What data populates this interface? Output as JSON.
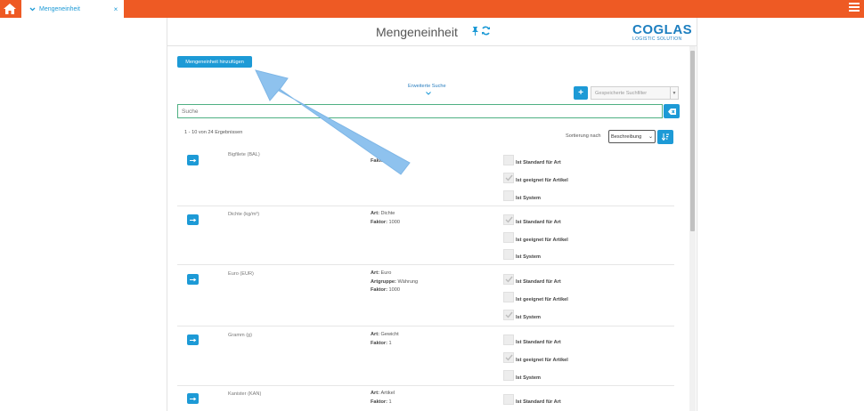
{
  "tab": {
    "label": "Mengeneinheit",
    "close": "×"
  },
  "header": {
    "title": "Mengeneinheit",
    "logo_main": "COGLAS",
    "logo_sub": "LOGISTIC SOLUTION"
  },
  "toolbar": {
    "add_label": "Mengeneinheit hinzufügen",
    "extended_search": "Erweiterte Suche",
    "plus": "+",
    "filter_placeholder": "Gespeicherte Suchfilter"
  },
  "search": {
    "placeholder": "Suche",
    "value": ""
  },
  "results": {
    "count_text": "1 - 10 von 24 Ergebnissen",
    "sort_label": "Sortierung nach",
    "sort_value": "Beschreibung"
  },
  "flag_labels": {
    "standard": "Ist Standard für Art",
    "suitable": "Ist geeignet für Artikel",
    "system": "Ist System"
  },
  "rows": [
    {
      "name": "Bigfilete (BAL)",
      "details": [
        {
          "key": "Faktor",
          "value": "1"
        }
      ],
      "flags": {
        "standard": false,
        "suitable": true,
        "system": false
      }
    },
    {
      "name": "Dichte (kg/m³)",
      "details": [
        {
          "key": "Art",
          "value": "Dichte"
        },
        {
          "key": "Faktor",
          "value": "1000"
        }
      ],
      "flags": {
        "standard": true,
        "suitable": false,
        "system": false
      }
    },
    {
      "name": "Euro (EUR)",
      "details": [
        {
          "key": "Art",
          "value": "Euro"
        },
        {
          "key": "Artgruppe",
          "value": "Währung"
        },
        {
          "key": "Faktor",
          "value": "1000"
        }
      ],
      "flags": {
        "standard": true,
        "suitable": false,
        "system": true
      }
    },
    {
      "name": "Gramm (g)",
      "details": [
        {
          "key": "Art",
          "value": "Gewicht"
        },
        {
          "key": "Faktor",
          "value": "1"
        }
      ],
      "flags": {
        "standard": false,
        "suitable": true,
        "system": false
      }
    },
    {
      "name": "Kanister (KAN)",
      "details": [
        {
          "key": "Art",
          "value": "Artikel"
        },
        {
          "key": "Faktor",
          "value": "1"
        }
      ],
      "flags": {
        "standard": false,
        "suitable": null,
        "system": null
      }
    }
  ],
  "colors": {
    "topbar": "#ee5a24",
    "accent": "#1d9ad6",
    "logo": "#1d7fc0",
    "search_border": "#4fb083",
    "hint_arrow": "#8ec2ee"
  },
  "icons": {
    "home": "home-icon",
    "tab_chevron": "chevron-down-icon",
    "menu": "hamburger-menu-icon",
    "pin": "pin-icon",
    "refresh": "refresh-icon",
    "clear": "eraser-icon",
    "sort_dir": "sort-direction-icon",
    "row_open": "arrow-right-icon",
    "check": "checkmark-icon"
  }
}
